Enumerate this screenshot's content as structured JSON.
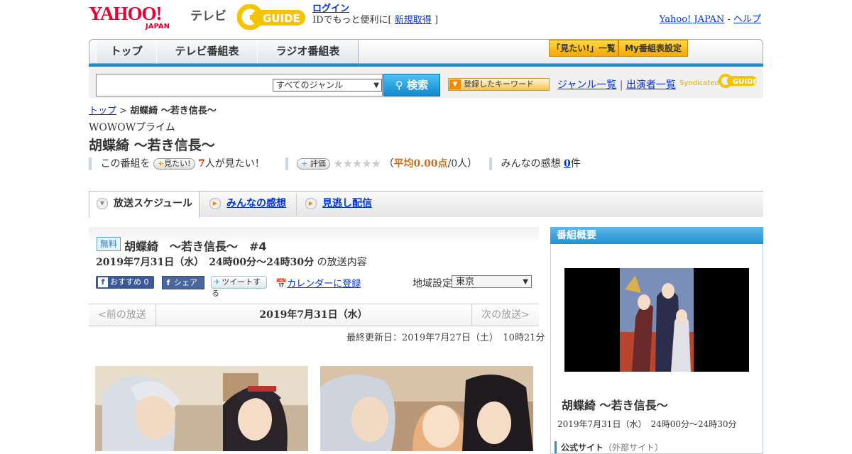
{
  "header": {
    "logo_text": "YAHOO!",
    "logo_sub": "JAPAN",
    "tv_label": "テレビ",
    "gguide_text": "GUIDE",
    "login_label": "ログイン",
    "login_prompt": "IDでもっと便利に[",
    "register_label": "新規取得",
    "register_close": "]",
    "yahoo_japan_link": "Yahoo! JAPAN",
    "separator": "-",
    "help_link": "ヘルプ"
  },
  "nav": {
    "tabs": [
      {
        "label": "トップ"
      },
      {
        "label": "テレビ番組表"
      },
      {
        "label": "ラジオ番組表"
      }
    ],
    "want_list_label": "「見たい!」一覧",
    "my_schedule_label": "My番組表設定"
  },
  "search": {
    "placeholder": "",
    "genre_selected": "すべてのジャンル",
    "search_button": "検索",
    "keyword_button": "登録したキーワード",
    "genre_list_link": "ジャンル一覧",
    "link_separator": "|",
    "cast_list_link": "出演者一覧",
    "syndicated": "Syndicated",
    "syndicated_logo": "GUIDE"
  },
  "breadcrumb": {
    "top_link": "トップ",
    "separator": ">",
    "current": "胡蝶綺 ～若き信長～"
  },
  "program": {
    "channel": "WOWOWプライム",
    "title": "胡蝶綺 ～若き信長～"
  },
  "stats": {
    "prefix": "この番組を",
    "want_button": "見たい!",
    "want_count": "7",
    "want_suffix": "人が見たい！",
    "rate_button": "評価",
    "stars": "★★★★★",
    "avg_open": "（",
    "avg_label": "平均0.00点",
    "avg_people": "/0人）",
    "impressions_label": "みんなの感想",
    "impressions_count": "0",
    "impressions_suffix": "件"
  },
  "tabs": {
    "schedule": "放送スケジュール",
    "impressions": "みんなの感想",
    "missed": "見逃し配信"
  },
  "episode": {
    "free_badge": "無料",
    "title": "胡蝶綺　～若き信長～　#4",
    "datetime": "2019年7月31日（水）　24時00分～24時30分",
    "datetime_suffix": "の放送内容",
    "fb_recommend": "おすすめ 0",
    "fb_share": "シェア",
    "tweet": "ツイートする",
    "calendar_link": "カレンダーに登録",
    "region_label": "地域設定",
    "region_value": "東京",
    "prev_link": "<前の放送",
    "current_date": "2019年7月31日（水）",
    "next_link": "次の放送>",
    "updated": "最終更新日：2019年7月27日（土）　10時21分"
  },
  "sidebar": {
    "heading": "番組概要",
    "title": "胡蝶綺 ～若き信長～",
    "datetime": "2019年7月31日（水）　24時00分～24時30分",
    "official_site": "公式サイト",
    "external": "（外部サイト）"
  },
  "colors": {
    "yahoo_red": "#e60033",
    "link_blue": "#0033cc",
    "nav_blue": "#1d8fd0",
    "accent_orange": "#f5a800"
  }
}
